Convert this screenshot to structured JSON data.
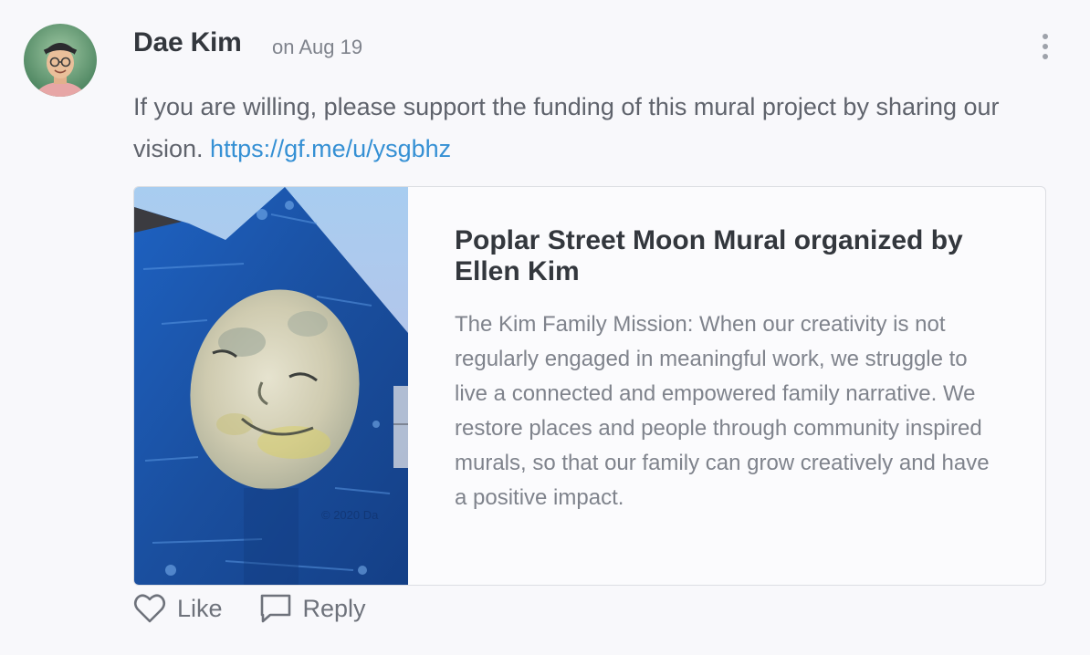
{
  "post": {
    "author": "Dae Kim",
    "date": "on Aug 19",
    "text": "If you are willing, please support the funding of this mural project by sharing our vision. ",
    "link": "https://gf.me/u/ysgbhz"
  },
  "card": {
    "title": "Poplar Street Moon Mural organized by Ellen Kim",
    "description": "The Kim Family Mission: When our creativity is not regularly engaged in meaningful work, we struggle to live a connected and empowered family narrative. We restore places and people through community inspired murals, so that our family can grow creatively and have a positive impact.",
    "image_watermark": "© 2020 Da"
  },
  "actions": {
    "like_label": "Like",
    "reply_label": "Reply"
  },
  "colors": {
    "link": "#3590d4",
    "mural_blue": "#1b56b0",
    "background": "#f8f8fb"
  },
  "icons": [
    "more-vertical-icon",
    "heart-icon",
    "reply-speech-bubble-icon"
  ]
}
